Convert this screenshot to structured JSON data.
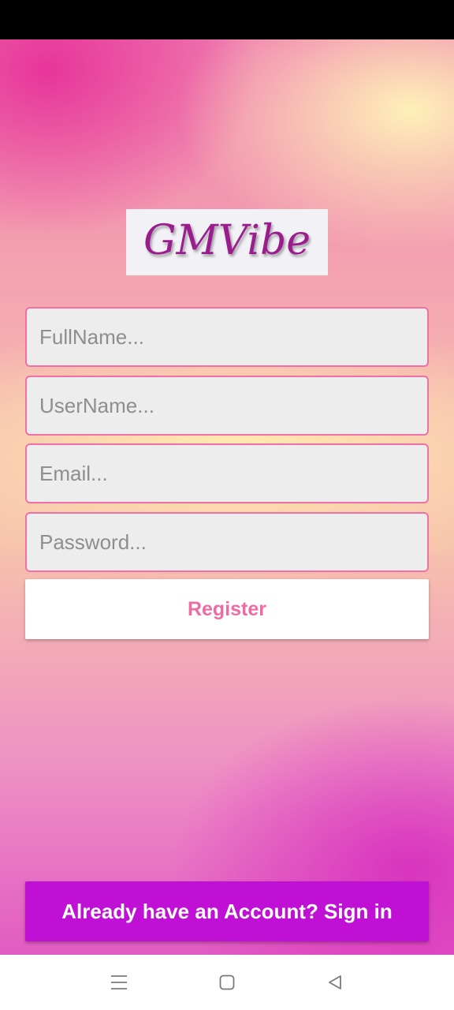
{
  "app": {
    "logo_text": "GMVibe",
    "colors": {
      "field_border": "#ef6fa6",
      "register_text": "#ef6ba4",
      "signin_background": "#c010d6",
      "logo_text": "#9b1f8c"
    }
  },
  "form": {
    "fullname_placeholder": "FullName...",
    "fullname_value": "",
    "username_placeholder": "UserName...",
    "username_value": "",
    "email_placeholder": "Email...",
    "email_value": "",
    "password_placeholder": "Password...",
    "password_value": "",
    "register_label": "Register"
  },
  "footer": {
    "signin_label": "Already have an Account? Sign in"
  },
  "navigation": {
    "icons": [
      "menu-icon",
      "home-icon",
      "back-icon"
    ]
  }
}
